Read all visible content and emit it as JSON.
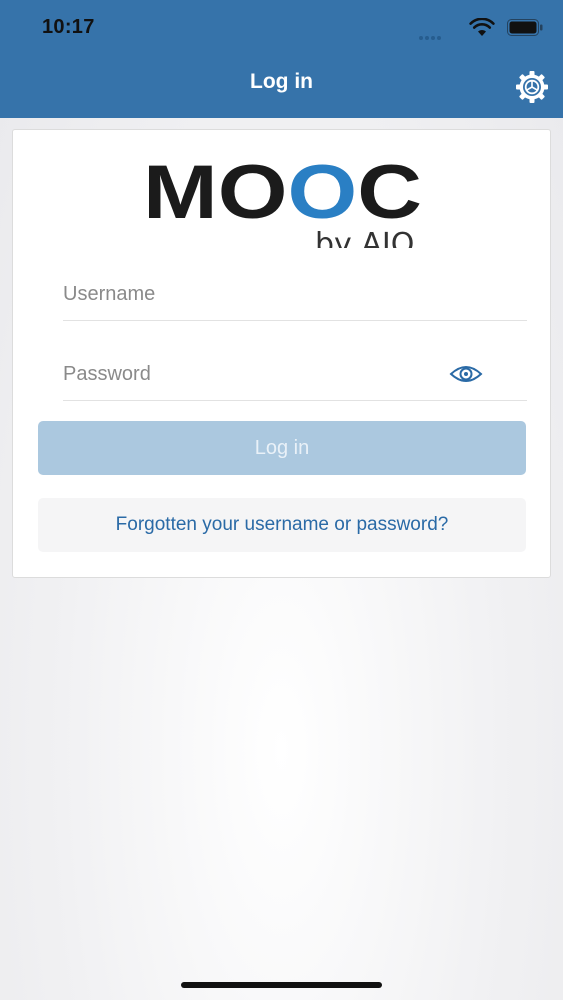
{
  "status_bar": {
    "time": "10:17",
    "icons": [
      "signal-icon",
      "wifi-icon",
      "battery-icon"
    ]
  },
  "header": {
    "title": "Log in",
    "settings_icon": "gear-icon"
  },
  "logo": {
    "brand": "MOOC",
    "sub": "by AIO",
    "colors": {
      "dark": "#1b1b1b",
      "accent": "#2a7fc4",
      "sub": "#333333"
    }
  },
  "form": {
    "username": {
      "value": "",
      "placeholder": "Username"
    },
    "password": {
      "value": "",
      "placeholder": "Password",
      "toggle_icon": "eye-icon"
    },
    "login_label": "Log in",
    "forgot_label": "Forgotten your username or password?"
  },
  "colors": {
    "header_bg": "#3673aa",
    "login_button_bg": "#abc8df",
    "link": "#2a6aa6"
  }
}
